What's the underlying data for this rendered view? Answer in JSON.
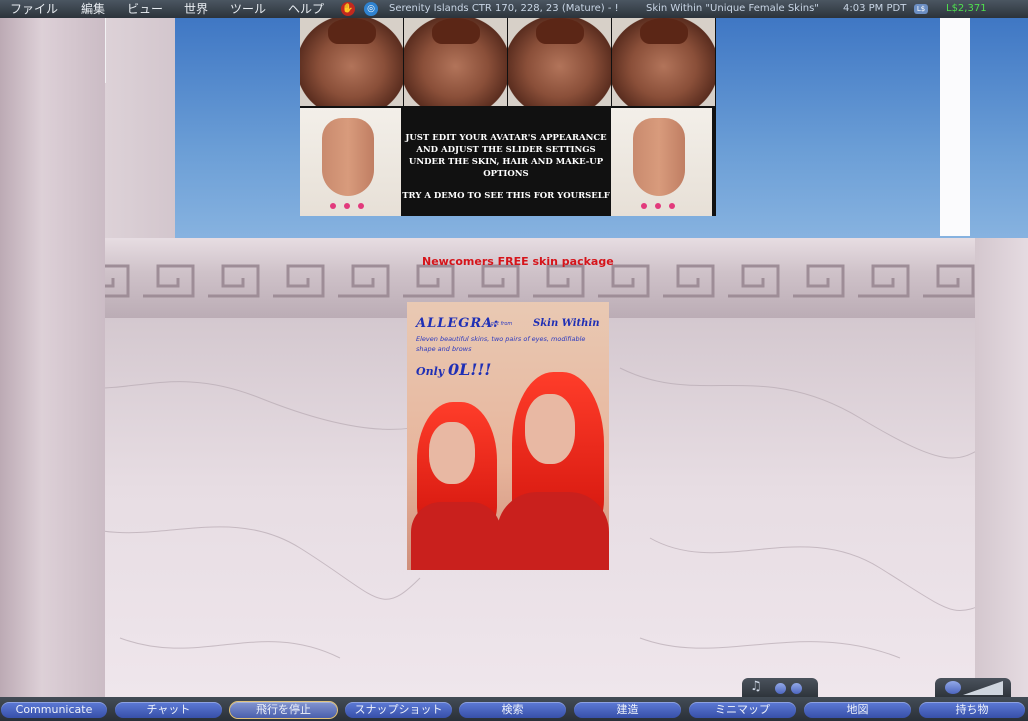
{
  "menu": {
    "items": [
      "ファイル",
      "編集",
      "ビュー",
      "世界",
      "ツール",
      "ヘルプ"
    ]
  },
  "status": {
    "location": "Serenity Islands CTR 170, 228, 23 (Mature) - !",
    "parcel": "Skin Within \"Unique Female Skins\"",
    "time": "4:03 PM PDT",
    "ls_badge": "L$",
    "balance": "L$2,371"
  },
  "scene": {
    "poster_top_text_1": "JUST EDIT YOUR AVATAR'S APPEARANCE AND ADJUST THE SLIDER SETTINGS UNDER THE SKIN, HAIR AND MAKE-UP OPTIONS",
    "poster_top_text_2": "TRY A DEMO TO SEE THIS FOR YOURSELF",
    "caption": "Newcomers FREE skin package",
    "poster_mid_title": "ALLEGRA:",
    "poster_mid_gift": "a gift from",
    "poster_mid_brand": "Skin Within",
    "poster_mid_desc": "Eleven beautiful skins, two pairs of eyes, modifiable shape and brows",
    "poster_mid_price_prefix": "Only ",
    "poster_mid_price": "0L!!!"
  },
  "toolbar": {
    "buttons": [
      "Communicate",
      "チャット",
      "飛行を停止",
      "スナップショット",
      "検索",
      "建造",
      "ミニマップ",
      "地図",
      "持ち物"
    ]
  },
  "colors": {
    "menubar": "#2c333b",
    "button": "#4863c4",
    "balance": "#4fe04f",
    "caption": "#d6141a"
  }
}
